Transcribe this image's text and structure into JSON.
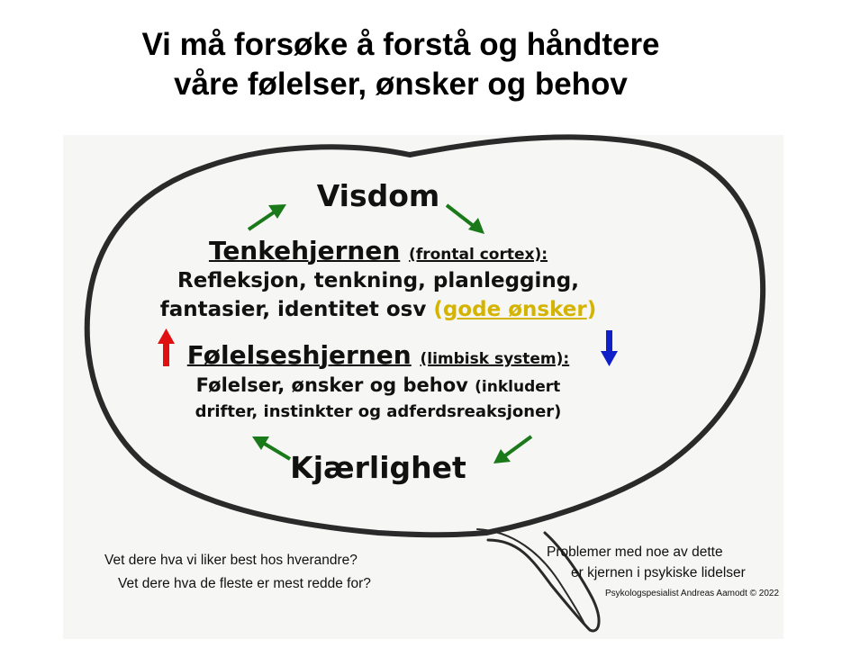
{
  "title": {
    "line1": "Vi må forsøke å forstå og håndtere",
    "line2": "våre følelser, ønsker og behov"
  },
  "diagram": {
    "top_label": "Visdom",
    "bottom_label": "Kjærlighet",
    "thinking_brain": {
      "heading": "Tenkehjernen",
      "heading_note": "(frontal cortex):",
      "line1": "Refleksjon, tenkning, planlegging,",
      "line2_prefix": "fantasier, identitet osv",
      "highlight_open": "(",
      "highlight_text": "gode ønsker",
      "highlight_close": ")"
    },
    "emotional_brain": {
      "heading": "Følelseshjernen",
      "heading_note": "(limbisk system):",
      "line1": "Følelser, ønsker og behov",
      "line1_note": "(inkludert",
      "line2": "drifter, instinkter og adferdsreaksjoner)"
    },
    "colors": {
      "cycle_arrows": "#1a7a1a",
      "up_arrow": "#e01010",
      "down_arrow": "#1020c8",
      "highlight": "#d4b400",
      "outline": "#2a2a2a"
    },
    "icons": [
      "brain-speech-bubble-outline",
      "arrow-up-right-icon",
      "arrow-down-right-icon",
      "arrow-down-left-icon",
      "arrow-up-left-icon",
      "red-up-arrow-icon",
      "blue-down-arrow-icon"
    ]
  },
  "footer": {
    "question1": "Vet dere hva vi liker best hos hverandre?",
    "question2": "Vet dere hva de fleste er mest redde for?",
    "problem_line1": "Problemer med noe av dette",
    "problem_line2": "er kjernen i psykiske lidelser",
    "credit": "Psykologspesialist Andreas Aamodt © 2022"
  }
}
